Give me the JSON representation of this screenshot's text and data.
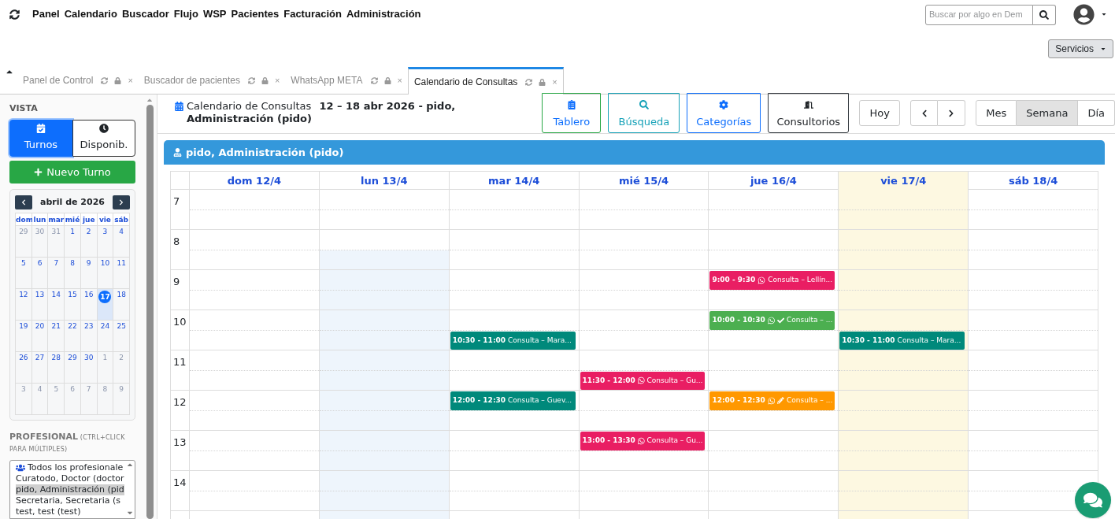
{
  "nav": {
    "items": [
      "Panel",
      "Calendario",
      "Buscador",
      "Flujo",
      "WSP",
      "Pacientes",
      "Facturación",
      "Administración"
    ],
    "search": {
      "placeholder": "Buscar por algo en Dem"
    },
    "services": "Servicios"
  },
  "tabs": [
    {
      "label": "Panel de Control",
      "close": "×",
      "selected": false
    },
    {
      "label": "Buscador de pacientes",
      "close": "×",
      "selected": false
    },
    {
      "label": "WhatsApp META",
      "close": "×",
      "selected": false
    },
    {
      "label": "Calendario de Consultas",
      "close": "×",
      "selected": true
    }
  ],
  "sidebar": {
    "vista_label": "VISTA",
    "views": [
      {
        "label": "Turnos",
        "kind": "calendar",
        "selected": true
      },
      {
        "label": "Disponib.",
        "kind": "clock",
        "selected": false
      }
    ],
    "new_button": "Nuevo Turno",
    "mini_calendar": {
      "title": "abril de 2026",
      "weekdays": [
        "dom",
        "lun",
        "mar",
        "mié",
        "jue",
        "vie",
        "sáb"
      ],
      "weeks": [
        [
          {
            "d": "29",
            "muted": true,
            "selected": false
          },
          {
            "d": "30",
            "muted": true,
            "selected": false
          },
          {
            "d": "31",
            "muted": true,
            "selected": false
          },
          {
            "d": "1",
            "muted": false,
            "selected": false
          },
          {
            "d": "2",
            "muted": false,
            "selected": false
          },
          {
            "d": "3",
            "muted": false,
            "selected": false
          },
          {
            "d": "4",
            "muted": false,
            "selected": false
          }
        ],
        [
          {
            "d": "5",
            "muted": false,
            "selected": false
          },
          {
            "d": "6",
            "muted": false,
            "selected": false
          },
          {
            "d": "7",
            "muted": false,
            "selected": false
          },
          {
            "d": "8",
            "muted": false,
            "selected": false
          },
          {
            "d": "9",
            "muted": false,
            "selected": false
          },
          {
            "d": "10",
            "muted": false,
            "selected": false
          },
          {
            "d": "11",
            "muted": false,
            "selected": false
          }
        ],
        [
          {
            "d": "12",
            "muted": false,
            "selected": false
          },
          {
            "d": "13",
            "muted": false,
            "selected": false
          },
          {
            "d": "14",
            "muted": false,
            "selected": false
          },
          {
            "d": "15",
            "muted": false,
            "selected": false
          },
          {
            "d": "16",
            "muted": false,
            "selected": false
          },
          {
            "d": "17",
            "muted": false,
            "selected": true
          },
          {
            "d": "18",
            "muted": false,
            "selected": false
          }
        ],
        [
          {
            "d": "19",
            "muted": false,
            "selected": false
          },
          {
            "d": "20",
            "muted": false,
            "selected": false
          },
          {
            "d": "21",
            "muted": false,
            "selected": false
          },
          {
            "d": "22",
            "muted": false,
            "selected": false
          },
          {
            "d": "23",
            "muted": false,
            "selected": false
          },
          {
            "d": "24",
            "muted": false,
            "selected": false
          },
          {
            "d": "25",
            "muted": false,
            "selected": false
          }
        ],
        [
          {
            "d": "26",
            "muted": false,
            "selected": false
          },
          {
            "d": "27",
            "muted": false,
            "selected": false
          },
          {
            "d": "28",
            "muted": false,
            "selected": false
          },
          {
            "d": "29",
            "muted": false,
            "selected": false
          },
          {
            "d": "30",
            "muted": false,
            "selected": false
          },
          {
            "d": "1",
            "muted": true,
            "selected": false
          },
          {
            "d": "2",
            "muted": true,
            "selected": false
          }
        ],
        [
          {
            "d": "3",
            "muted": true,
            "selected": false
          },
          {
            "d": "4",
            "muted": true,
            "selected": false
          },
          {
            "d": "5",
            "muted": true,
            "selected": false
          },
          {
            "d": "6",
            "muted": true,
            "selected": false
          },
          {
            "d": "7",
            "muted": true,
            "selected": false
          },
          {
            "d": "8",
            "muted": true,
            "selected": false
          },
          {
            "d": "9",
            "muted": true,
            "selected": false
          }
        ]
      ]
    },
    "professional_heading": "**PROFESIONAL** (CTRL+CLICK PARA MÚLTIPLES)",
    "professionals": [
      {
        "label": "Todos los profesionale",
        "kind": "group",
        "selected": false
      },
      {
        "label": "Curatodo, Doctor (doctor",
        "kind": "person",
        "selected": false
      },
      {
        "label": "pido, Administración (pid",
        "kind": "person",
        "selected": true
      },
      {
        "label": "Secretaria, Secretaria (s",
        "kind": "person",
        "selected": false
      },
      {
        "label": "test, test (test)",
        "kind": "person",
        "selected": false
      }
    ]
  },
  "header": {
    "title": "Calendario de Consultas",
    "range": "12 – 18 abr 2026 - pido, Administración (pido)",
    "tools": [
      {
        "label": "Tablero",
        "kind": "clipboard"
      },
      {
        "label": "Búsqueda",
        "kind": "search"
      },
      {
        "label": "Categorías",
        "kind": "gear"
      },
      {
        "label": "Consultorios",
        "kind": "door"
      }
    ],
    "today": "Hoy",
    "views": [
      {
        "label": "Mes",
        "selected": false
      },
      {
        "label": "Semana",
        "selected": true
      },
      {
        "label": "Día",
        "selected": false
      }
    ]
  },
  "calendar": {
    "banner": "pido, Administración (pido)",
    "hours": [
      "7",
      "8",
      "9",
      "10",
      "11",
      "12",
      "13",
      "14"
    ],
    "days": [
      {
        "label": "dom 12/4",
        "today": false,
        "unavailable": false
      },
      {
        "label": "lun 13/4",
        "today": false,
        "unavailable": true
      },
      {
        "label": "mar 14/4",
        "today": false,
        "unavailable": false,
        "events": [
          {
            "time": "10:30 - 11:00",
            "whatsapp": false,
            "confirmed": false,
            "edited": false,
            "title": "Consulta – Mara...",
            "color": "#00897b"
          },
          {
            "time": "12:00 - 12:30",
            "whatsapp": false,
            "confirmed": false,
            "edited": false,
            "title": "Consulta – Guev...",
            "color": "#00897b"
          }
        ]
      },
      {
        "label": "mié 15/4",
        "today": false,
        "unavailable": false,
        "events": [
          {
            "time": "11:30 - 12:00",
            "whatsapp": true,
            "confirmed": false,
            "edited": false,
            "title": "Consulta – Gu...",
            "color": "#e91e63"
          },
          {
            "time": "13:00 - 13:30",
            "whatsapp": true,
            "confirmed": false,
            "edited": false,
            "title": "Consulta – Gu...",
            "color": "#e91e63"
          }
        ]
      },
      {
        "label": "jue 16/4",
        "today": false,
        "unavailable": false,
        "events": [
          {
            "time": "9:00 - 9:30",
            "whatsapp": true,
            "confirmed": false,
            "edited": false,
            "title": "Consulta – Lellín...",
            "color": "#e91e63"
          },
          {
            "time": "10:00 - 10:30",
            "whatsapp": true,
            "confirmed": true,
            "edited": false,
            "title": "Consulta – ...",
            "color": "#4caf50"
          },
          {
            "time": "12:00 - 12:30",
            "whatsapp": true,
            "confirmed": false,
            "edited": true,
            "title": "Consulta – ...",
            "color": "#ff9800"
          }
        ]
      },
      {
        "label": "vie 17/4",
        "today": true,
        "unavailable": false,
        "events": [
          {
            "time": "10:30 - 11:00",
            "whatsapp": false,
            "confirmed": false,
            "edited": false,
            "title": "Consulta – Mara...",
            "color": "#00897b"
          }
        ]
      },
      {
        "label": "sáb 18/4",
        "today": false,
        "unavailable": false
      }
    ]
  }
}
